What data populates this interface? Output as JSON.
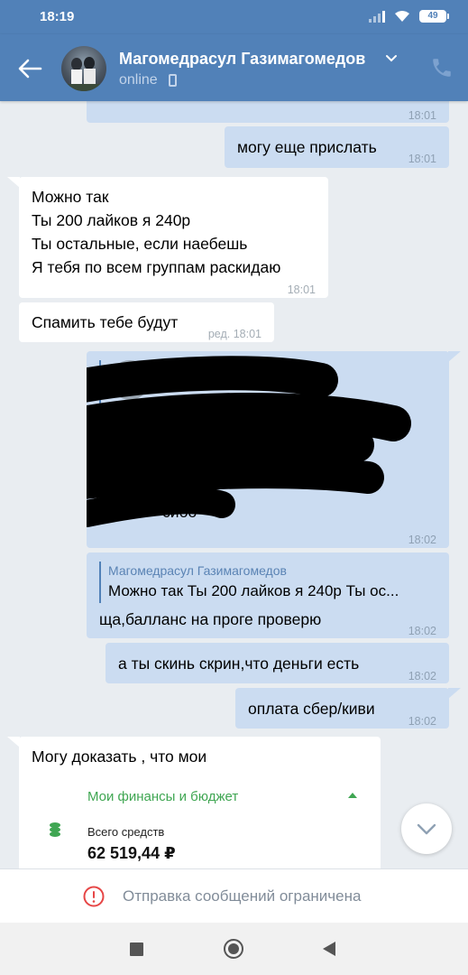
{
  "status_bar": {
    "time": "18:19",
    "battery": "49"
  },
  "header": {
    "contact_name": "Магомедрасул Газимагомедов",
    "status": "online"
  },
  "messages": [
    {
      "id": "m0",
      "direction": "out",
      "time": "18:01"
    },
    {
      "id": "m1",
      "direction": "out",
      "text": "могу еще прислать",
      "time": "18:01"
    },
    {
      "id": "m2",
      "direction": "in",
      "lines": [
        "Можно так",
        "Ты 200 лайков я 240р",
        "Ты остальные, если наебешь",
        "Я тебя по всем группам раскидаю"
      ],
      "time": "18:01"
    },
    {
      "id": "m3",
      "direction": "in",
      "text": "Спамить тебе будут",
      "time": "ред. 18:01"
    },
    {
      "id": "m4",
      "direction": "out",
      "visible_text": "сибо",
      "time": "18:02"
    },
    {
      "id": "m5",
      "direction": "out",
      "reply_author": "Магомедрасул Газимагомедов",
      "reply_text": "Можно так Ты 200 лайков я 240р  Ты ос...",
      "text": "ща,балланс на проге проверю",
      "time": "18:02"
    },
    {
      "id": "m6",
      "direction": "out",
      "text": "а ты скинь скрин,что деньги есть",
      "time": "18:02"
    },
    {
      "id": "m7",
      "direction": "out",
      "text": "оплата сбер/киви",
      "time": "18:02"
    },
    {
      "id": "m8",
      "direction": "in",
      "text": "Могу доказать , что мои",
      "finance_card": {
        "title": "Мои финансы и бюджет",
        "label": "Всего средств",
        "amount": "62 519,44 ₽"
      }
    }
  ],
  "restriction": {
    "text": "Отправка сообщений ограничена"
  },
  "colors": {
    "header": "#5181b8",
    "outgoing_bubble": "#cbdcf1",
    "incoming_bubble": "#ffffff",
    "background": "#e9edf1",
    "finance_green": "#3fa652",
    "warning_red": "#e64646"
  },
  "icons": [
    "back-arrow-icon",
    "chevron-down-icon",
    "mobile-icon",
    "phone-icon",
    "coins-icon",
    "warning-icon",
    "scroll-down-icon",
    "signal-icon",
    "wifi-icon",
    "battery-icon"
  ]
}
